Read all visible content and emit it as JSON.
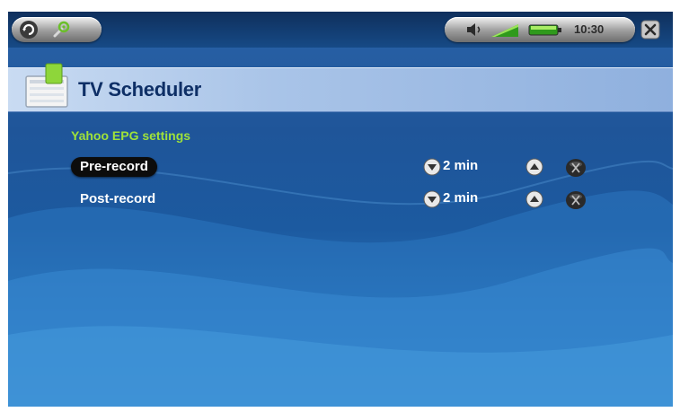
{
  "status_bar": {
    "time": "10:30",
    "left_icons": [
      "refresh-icon",
      "settings-icon"
    ],
    "right_icons": [
      "speaker-icon",
      "signal-icon",
      "battery-icon"
    ],
    "close_icon": "close-icon"
  },
  "header": {
    "title": "TV Scheduler",
    "icon": "tv-scheduler-icon"
  },
  "section_title": "Yahoo EPG settings",
  "settings": [
    {
      "label": "Pre-record",
      "value": "2 min",
      "selected": true
    },
    {
      "label": "Post-record",
      "value": "2 min",
      "selected": false
    }
  ],
  "colors": {
    "section_title": "#9fe23a",
    "title": "#0e2f66",
    "background": "#1f5599",
    "selected_row": "#0c0c0c"
  }
}
